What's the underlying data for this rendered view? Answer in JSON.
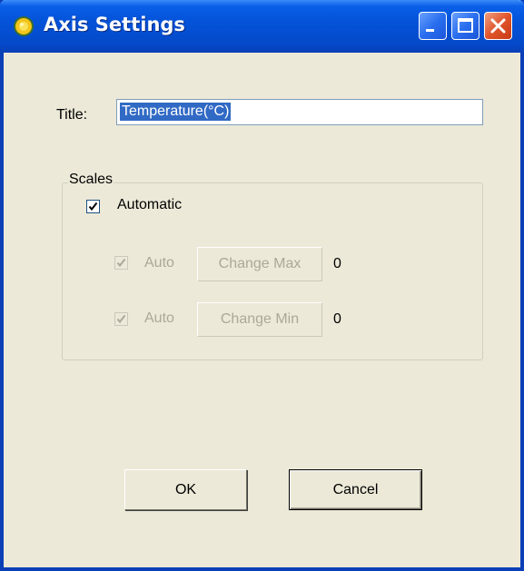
{
  "window": {
    "title": "Axis Settings",
    "icon": "app-sun-icon",
    "controls": [
      "minimize-icon",
      "maximize-icon",
      "close-icon"
    ]
  },
  "form": {
    "title_label": "Title:",
    "title_value": "Temperature(°C)"
  },
  "scales": {
    "group_label": "Scales",
    "automatic_label": "Automatic",
    "automatic_checked": true,
    "max": {
      "auto_label": "Auto",
      "auto_checked": true,
      "button_label": "Change Max",
      "value": "0",
      "enabled": false
    },
    "min": {
      "auto_label": "Auto",
      "auto_checked": true,
      "button_label": "Change Min",
      "value": "0",
      "enabled": false
    }
  },
  "buttons": {
    "ok_label": "OK",
    "cancel_label": "Cancel"
  },
  "colors": {
    "titlebar": "#0453d9",
    "dialog_bg": "#ece9d8",
    "selection": "#316ac5",
    "close_button": "#e0552c",
    "disabled_text": "#aca899"
  }
}
